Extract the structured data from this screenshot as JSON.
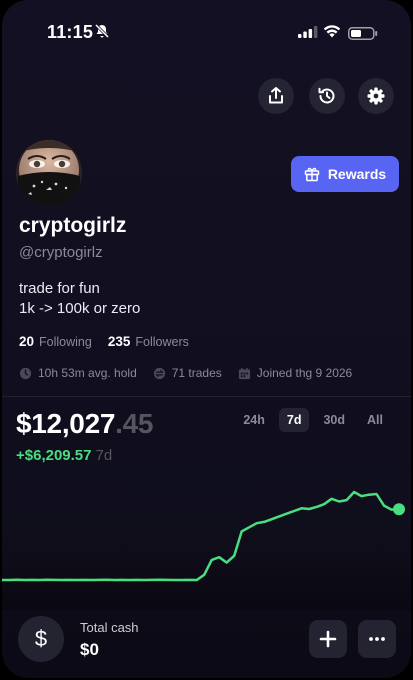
{
  "status_bar": {
    "time": "11:15"
  },
  "header_actions": [
    {
      "icon": "share-icon"
    },
    {
      "icon": "history-icon"
    },
    {
      "icon": "gear-icon"
    }
  ],
  "profile": {
    "name": "cryptogirlz",
    "handle": "@cryptogirlz",
    "bio_lines": [
      "trade for fun",
      "1k -> 100k or zero"
    ],
    "following_count": "20",
    "following_label": "Following",
    "followers_count": "235",
    "followers_label": "Followers",
    "avg_hold": "10h 53m avg. hold",
    "trades": "71 trades",
    "joined": "Joined thg 9 2026"
  },
  "rewards_button": {
    "label": "Rewards",
    "color": "#5865f2"
  },
  "balance": {
    "whole": "$12,027",
    "cents": ".45",
    "change": "+$6,209.57",
    "change_period": "7d",
    "change_color": "#4ade80"
  },
  "time_ranges": [
    {
      "label": "24h",
      "active": false
    },
    {
      "label": "7d",
      "active": true
    },
    {
      "label": "30d",
      "active": false
    },
    {
      "label": "All",
      "active": false
    }
  ],
  "chart_data": {
    "type": "line",
    "title": "",
    "xlabel": "",
    "ylabel": "",
    "line_color": "#4ade80",
    "values": [
      5818,
      5818,
      5830,
      5818,
      5825,
      5818,
      5830,
      5822,
      5818,
      5825,
      5818,
      5822,
      5818,
      5822,
      5830,
      5818,
      5822,
      5818,
      5825,
      5818,
      5822,
      5830,
      5825,
      5818,
      5818,
      5822,
      5818,
      6200,
      7300,
      7500,
      7100,
      7600,
      9400,
      9700,
      10000,
      10100,
      10300,
      10500,
      10700,
      10900,
      11100,
      11050,
      11200,
      11400,
      11800,
      11600,
      11700,
      12300,
      12000,
      12100,
      12150,
      11300,
      11000,
      11030
    ]
  },
  "bottom_bar": {
    "cash_label": "Total cash",
    "cash_value": "$0",
    "cash_icon": "$"
  }
}
